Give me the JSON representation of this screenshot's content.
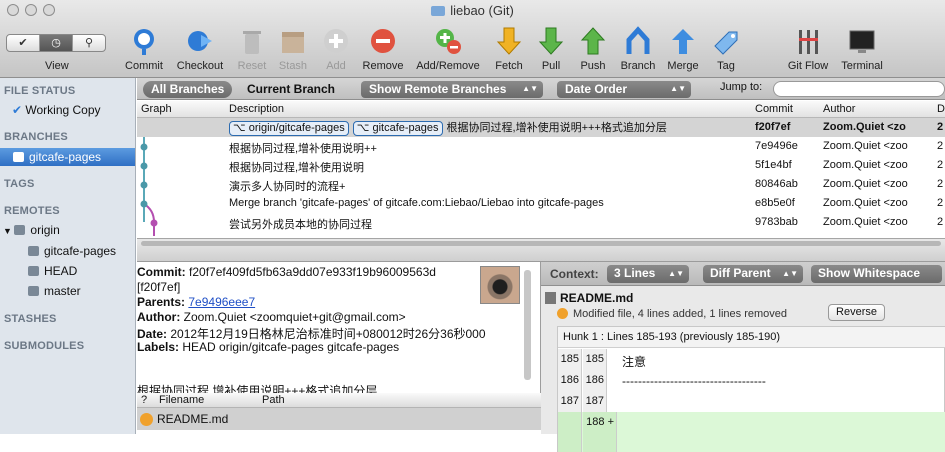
{
  "window": {
    "title": "liebao (Git)"
  },
  "view": {
    "label": "View",
    "segments": [
      "✔",
      "◷",
      "⚲"
    ]
  },
  "toolbar": {
    "commit": "Commit",
    "checkout": "Checkout",
    "reset": "Reset",
    "stash": "Stash",
    "add": "Add",
    "remove": "Remove",
    "add_remove": "Add/Remove",
    "fetch": "Fetch",
    "pull": "Pull",
    "push": "Push",
    "branch": "Branch",
    "merge": "Merge",
    "tag": "Tag",
    "gitflow": "Git Flow",
    "terminal": "Terminal"
  },
  "sidebar": {
    "file_status": "FILE STATUS",
    "working_copy": "Working Copy",
    "branches": "BRANCHES",
    "current_branch": "gitcafe-pages",
    "tags": "TAGS",
    "remotes": "REMOTES",
    "origin": "origin",
    "remote_items": [
      "gitcafe-pages",
      "HEAD",
      "master"
    ],
    "stashes": "STASHES",
    "submodules": "SUBMODULES"
  },
  "tabs": {
    "all_branches": "All Branches",
    "current_branch": "Current Branch",
    "show_remote": "Show Remote Branches",
    "date_order": "Date Order",
    "jump_to": "Jump to:"
  },
  "columns": {
    "graph": "Graph",
    "description": "Description",
    "commit": "Commit",
    "author": "Author",
    "date": "D"
  },
  "commits": [
    {
      "tags": [
        "origin/gitcafe-pages",
        "gitcafe-pages"
      ],
      "desc": "根据协同过程,增补使用说明+++格式追加分层",
      "hash": "f20f7ef",
      "author": "Zoom.Quiet <zo",
      "date": "2"
    },
    {
      "tags": [],
      "desc": "根据协同过程,增补使用说明++",
      "hash": "7e9496e",
      "author": "Zoom.Quiet <zoo",
      "date": "2"
    },
    {
      "tags": [],
      "desc": "根据协同过程,增补使用说明",
      "hash": "5f1e4bf",
      "author": "Zoom.Quiet <zoo",
      "date": "2"
    },
    {
      "tags": [],
      "desc": "演示多人协同时的流程+",
      "hash": "80846ab",
      "author": "Zoom.Quiet <zoo",
      "date": "2"
    },
    {
      "tags": [],
      "desc": "Merge branch 'gitcafe-pages' of gitcafe.com:Liebao/Liebao into gitcafe-pages",
      "hash": "e8b5e0f",
      "author": "Zoom.Quiet <zoo",
      "date": "2"
    },
    {
      "tags": [],
      "desc": "尝试另外成员本地的协同过程",
      "hash": "9783bab",
      "author": "Zoom.Quiet <zoo",
      "date": "2"
    }
  ],
  "detail": {
    "commit_label": "Commit:",
    "commit_value": "f20f7ef409fd5fb63a9dd07e933f19b96009563d",
    "commit_short": "[f20f7ef]",
    "parents_label": "Parents:",
    "parents_value": "7e9496eee7",
    "author_label": "Author:",
    "author_value": "Zoom.Quiet <zoomquiet+git@gmail.com>",
    "date_label": "Date:",
    "date_value": "2012年12月19日格林尼治标准时间+080012时26分36秒000",
    "labels_label": "Labels:",
    "labels_value": "HEAD origin/gitcafe-pages gitcafe-pages",
    "message": "根据协同过程,增补使用说明+++格式追加分层"
  },
  "files": {
    "col_status": "?",
    "col_filename": "Filename",
    "col_path": "Path",
    "items": [
      "README.md"
    ]
  },
  "diff": {
    "context_label": "Context:",
    "context_value": "3 Lines",
    "diff_parent": "Diff Parent",
    "show_whitespace": "Show Whitespace",
    "file": "README.md",
    "summary": "Modified file, 4 lines added, 1 lines removed",
    "reverse": "Reverse",
    "hunk": "Hunk 1 : Lines 185-193 (previously 185-190)",
    "lines": [
      {
        "old": "185",
        "new": "185",
        "text": "注意",
        "kind": "ctx"
      },
      {
        "old": "186",
        "new": "186",
        "text": "------------------------------------",
        "kind": "ctx"
      },
      {
        "old": "187",
        "new": "187",
        "text": "",
        "kind": "ctx"
      },
      {
        "old": "",
        "new": "188 +",
        "text": "",
        "kind": "add"
      }
    ]
  }
}
